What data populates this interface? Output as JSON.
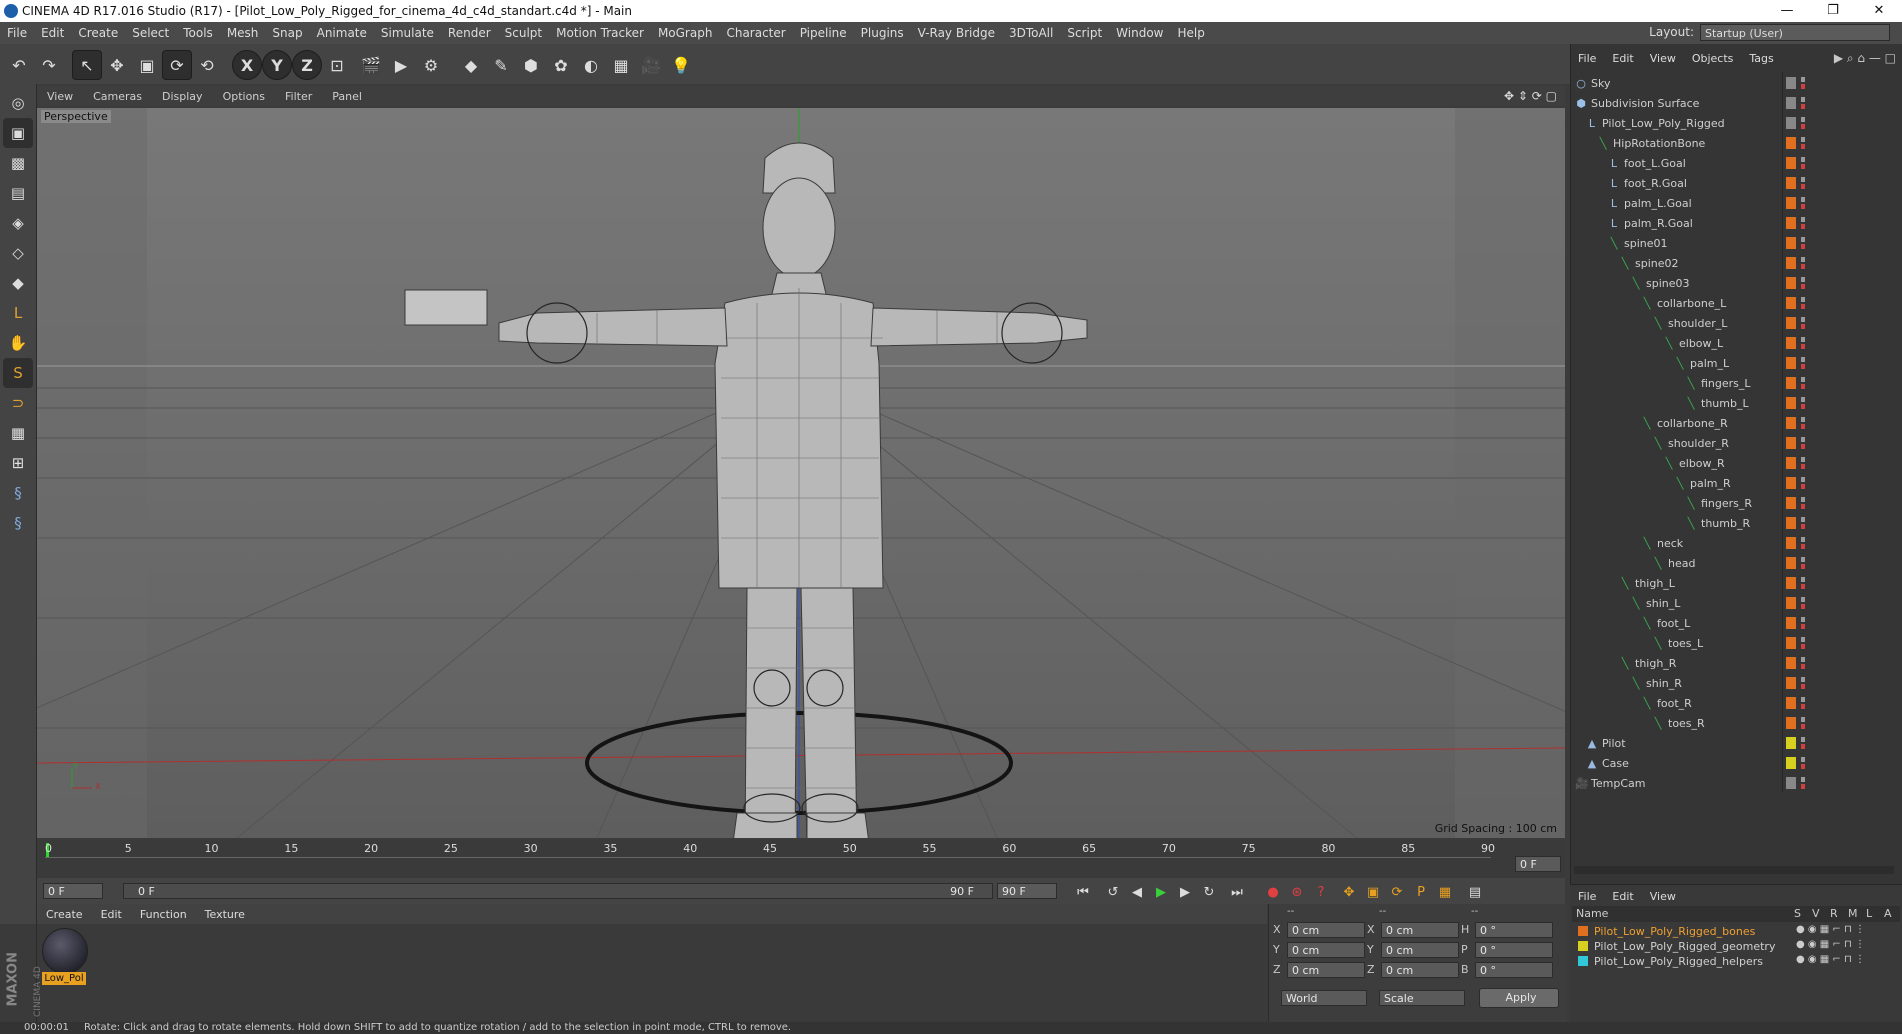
{
  "window": {
    "title": "CINEMA 4D R17.016 Studio (R17) - [Pilot_Low_Poly_Rigged_for_cinema_4d_c4d_standart.c4d *] - Main",
    "min": "—",
    "restore": "❐",
    "close": "✕"
  },
  "menubar": {
    "items": [
      "File",
      "Edit",
      "Create",
      "Select",
      "Tools",
      "Mesh",
      "Snap",
      "Animate",
      "Simulate",
      "Render",
      "Sculpt",
      "Motion Tracker",
      "MoGraph",
      "Character",
      "Pipeline",
      "Plugins",
      "V-Ray Bridge",
      "3DToAll",
      "Script",
      "Window",
      "Help"
    ],
    "layout_label": "Layout:",
    "layout_value": "Startup (User)"
  },
  "toolbar": {
    "icons": [
      {
        "name": "undo-icon",
        "glyph": "↶",
        "sel": false
      },
      {
        "name": "redo-icon",
        "glyph": "↷",
        "sel": false
      },
      {
        "name": "select-arrow-icon",
        "glyph": "↖",
        "sel": true
      },
      {
        "name": "move-icon",
        "glyph": "✥",
        "sel": false
      },
      {
        "name": "scale-icon",
        "glyph": "▣",
        "sel": false
      },
      {
        "name": "rotate-icon",
        "glyph": "⟳",
        "sel": true
      },
      {
        "name": "recent-tool-icon",
        "glyph": "⟲",
        "sel": false
      },
      {
        "name": "x-axis-icon",
        "glyph": "X",
        "sel": true
      },
      {
        "name": "y-axis-icon",
        "glyph": "Y",
        "sel": true
      },
      {
        "name": "z-axis-icon",
        "glyph": "Z",
        "sel": true
      },
      {
        "name": "coordinate-system-icon",
        "glyph": "⊡",
        "sel": false
      },
      {
        "name": "render-view-icon",
        "glyph": "🎬",
        "sel": false
      },
      {
        "name": "render-picture-viewer-icon",
        "glyph": "▶",
        "sel": false
      },
      {
        "name": "render-settings-icon",
        "glyph": "⚙",
        "sel": false
      },
      {
        "name": "cube-icon",
        "glyph": "◆",
        "sel": false
      },
      {
        "name": "pen-icon",
        "glyph": "✎",
        "sel": false
      },
      {
        "name": "subdivision-icon",
        "glyph": "⬢",
        "sel": false
      },
      {
        "name": "array-icon",
        "glyph": "✿",
        "sel": false
      },
      {
        "name": "deformer-icon",
        "glyph": "◐",
        "sel": false
      },
      {
        "name": "floor-icon",
        "glyph": "▦",
        "sel": false
      },
      {
        "name": "camera-icon",
        "glyph": "🎥",
        "sel": false
      },
      {
        "name": "light-icon",
        "glyph": "💡",
        "sel": false
      }
    ]
  },
  "leftbar": {
    "icons": [
      {
        "name": "make-editable-icon",
        "glyph": "◎"
      },
      {
        "name": "model-mode-icon",
        "glyph": "▣"
      },
      {
        "name": "texture-mode-icon",
        "glyph": "▩"
      },
      {
        "name": "workplane-icon",
        "glyph": "▤"
      },
      {
        "name": "points-mode-icon",
        "glyph": "◈"
      },
      {
        "name": "edges-mode-icon",
        "glyph": "◇"
      },
      {
        "name": "polygons-mode-icon",
        "glyph": "◆"
      },
      {
        "name": "axis-icon",
        "glyph": "L"
      },
      {
        "name": "tweak-icon",
        "glyph": "✋"
      },
      {
        "name": "solo-icon",
        "glyph": "S"
      },
      {
        "name": "snap-icon",
        "glyph": "⊃"
      },
      {
        "name": "grid-snap-icon",
        "glyph": "▦"
      },
      {
        "name": "workplane-snap-icon",
        "glyph": "⊞"
      },
      {
        "name": "python-icon",
        "glyph": "§"
      },
      {
        "name": "python-script-icon",
        "glyph": "§"
      }
    ]
  },
  "viewport": {
    "menu": [
      "View",
      "Cameras",
      "Display",
      "Options",
      "Filter",
      "Panel"
    ],
    "label": "Perspective",
    "grid_spacing": "Grid Spacing : 100 cm",
    "axis_x": "X",
    "axis_y": "Y"
  },
  "timeline": {
    "ticks": [
      "0",
      "5",
      "10",
      "15",
      "20",
      "25",
      "30",
      "35",
      "40",
      "45",
      "50",
      "55",
      "60",
      "65",
      "70",
      "75",
      "80",
      "85",
      "90"
    ],
    "frame_display": "0 F",
    "start_frame": "0 F",
    "range_start": "0 F",
    "range_end": "90 F",
    "end_frame": "90 F"
  },
  "material_panel": {
    "menu": [
      "Create",
      "Edit",
      "Function",
      "Texture"
    ],
    "material_name": "Low_Pol",
    "brand_top": "MAXON",
    "brand_bottom": "CINEMA 4D"
  },
  "coord_panel": {
    "headers": [
      "--",
      "--",
      "--"
    ],
    "rows": [
      {
        "a": "X",
        "av": "0 cm",
        "b": "X",
        "bv": "0 cm",
        "c": "H",
        "cv": "0 °"
      },
      {
        "a": "Y",
        "av": "0 cm",
        "b": "Y",
        "bv": "0 cm",
        "c": "P",
        "cv": "0 °"
      },
      {
        "a": "Z",
        "av": "0 cm",
        "b": "Z",
        "bv": "0 cm",
        "c": "B",
        "cv": "0 °"
      }
    ],
    "space": "World",
    "mode": "Scale",
    "apply": "Apply"
  },
  "object_manager": {
    "menu": [
      "File",
      "Edit",
      "View",
      "Objects",
      "Tags"
    ],
    "objects": [
      {
        "name": "Sky",
        "indent": 0,
        "icon": "○",
        "color": "gray"
      },
      {
        "name": "Subdivision Surface",
        "indent": 0,
        "icon": "⬢",
        "color": "gray"
      },
      {
        "name": "Pilot_Low_Poly_Rigged",
        "indent": 1,
        "icon": "L",
        "color": "gray"
      },
      {
        "name": "HipRotationBone",
        "indent": 2,
        "icon": "╲",
        "color": "orange"
      },
      {
        "name": "foot_L.Goal",
        "indent": 3,
        "icon": "L",
        "color": "orange"
      },
      {
        "name": "foot_R.Goal",
        "indent": 3,
        "icon": "L",
        "color": "orange"
      },
      {
        "name": "palm_L.Goal",
        "indent": 3,
        "icon": "L",
        "color": "orange"
      },
      {
        "name": "palm_R.Goal",
        "indent": 3,
        "icon": "L",
        "color": "orange"
      },
      {
        "name": "spine01",
        "indent": 3,
        "icon": "╲",
        "color": "orange"
      },
      {
        "name": "spine02",
        "indent": 4,
        "icon": "╲",
        "color": "orange"
      },
      {
        "name": "spine03",
        "indent": 5,
        "icon": "╲",
        "color": "orange"
      },
      {
        "name": "collarbone_L",
        "indent": 6,
        "icon": "╲",
        "color": "orange"
      },
      {
        "name": "shoulder_L",
        "indent": 7,
        "icon": "╲",
        "color": "orange"
      },
      {
        "name": "elbow_L",
        "indent": 8,
        "icon": "╲",
        "color": "orange"
      },
      {
        "name": "palm_L",
        "indent": 9,
        "icon": "╲",
        "color": "orange"
      },
      {
        "name": "fingers_L",
        "indent": 10,
        "icon": "╲",
        "color": "orange"
      },
      {
        "name": "thumb_L",
        "indent": 10,
        "icon": "╲",
        "color": "orange"
      },
      {
        "name": "collarbone_R",
        "indent": 6,
        "icon": "╲",
        "color": "orange"
      },
      {
        "name": "shoulder_R",
        "indent": 7,
        "icon": "╲",
        "color": "orange"
      },
      {
        "name": "elbow_R",
        "indent": 8,
        "icon": "╲",
        "color": "orange"
      },
      {
        "name": "palm_R",
        "indent": 9,
        "icon": "╲",
        "color": "orange"
      },
      {
        "name": "fingers_R",
        "indent": 10,
        "icon": "╲",
        "color": "orange"
      },
      {
        "name": "thumb_R",
        "indent": 10,
        "icon": "╲",
        "color": "orange"
      },
      {
        "name": "neck",
        "indent": 6,
        "icon": "╲",
        "color": "orange"
      },
      {
        "name": "head",
        "indent": 7,
        "icon": "╲",
        "color": "orange"
      },
      {
        "name": "thigh_L",
        "indent": 4,
        "icon": "╲",
        "color": "orange"
      },
      {
        "name": "shin_L",
        "indent": 5,
        "icon": "╲",
        "color": "orange"
      },
      {
        "name": "foot_L",
        "indent": 6,
        "icon": "╲",
        "color": "orange"
      },
      {
        "name": "toes_L",
        "indent": 7,
        "icon": "╲",
        "color": "orange"
      },
      {
        "name": "thigh_R",
        "indent": 4,
        "icon": "╲",
        "color": "orange"
      },
      {
        "name": "shin_R",
        "indent": 5,
        "icon": "╲",
        "color": "orange"
      },
      {
        "name": "foot_R",
        "indent": 6,
        "icon": "╲",
        "color": "orange"
      },
      {
        "name": "toes_R",
        "indent": 7,
        "icon": "╲",
        "color": "orange"
      },
      {
        "name": "Pilot",
        "indent": 1,
        "icon": "▲",
        "color": "yellow"
      },
      {
        "name": "Case",
        "indent": 1,
        "icon": "▲",
        "color": "yellow"
      },
      {
        "name": "TempCam",
        "indent": 0,
        "icon": "🎥",
        "color": "gray"
      }
    ]
  },
  "layer_manager": {
    "menu": [
      "File",
      "Edit",
      "View"
    ],
    "headers": {
      "name": "Name",
      "s": "S",
      "v": "V",
      "r": "R",
      "m": "M",
      "l": "L",
      "a": "A"
    },
    "layers": [
      {
        "name": "Pilot_Low_Poly_Rigged_bones",
        "color": "#e07020",
        "text": "#f0a030"
      },
      {
        "name": "Pilot_Low_Poly_Rigged_geometry",
        "color": "#d8d020",
        "text": "#d0d0d0"
      },
      {
        "name": "Pilot_Low_Poly_Rigged_helpers",
        "color": "#30c8d8",
        "text": "#d0d0d0"
      }
    ]
  },
  "status": {
    "time": "00:00:01",
    "text": "Rotate: Click and drag to rotate elements. Hold down SHIFT to add to quantize rotation / add to the selection in point mode, CTRL to remove."
  },
  "colors": {
    "accent": "#e8a020",
    "bone_tag": "#e07020",
    "geo_tag": "#d8d020",
    "helper_tag": "#30c8d8"
  }
}
